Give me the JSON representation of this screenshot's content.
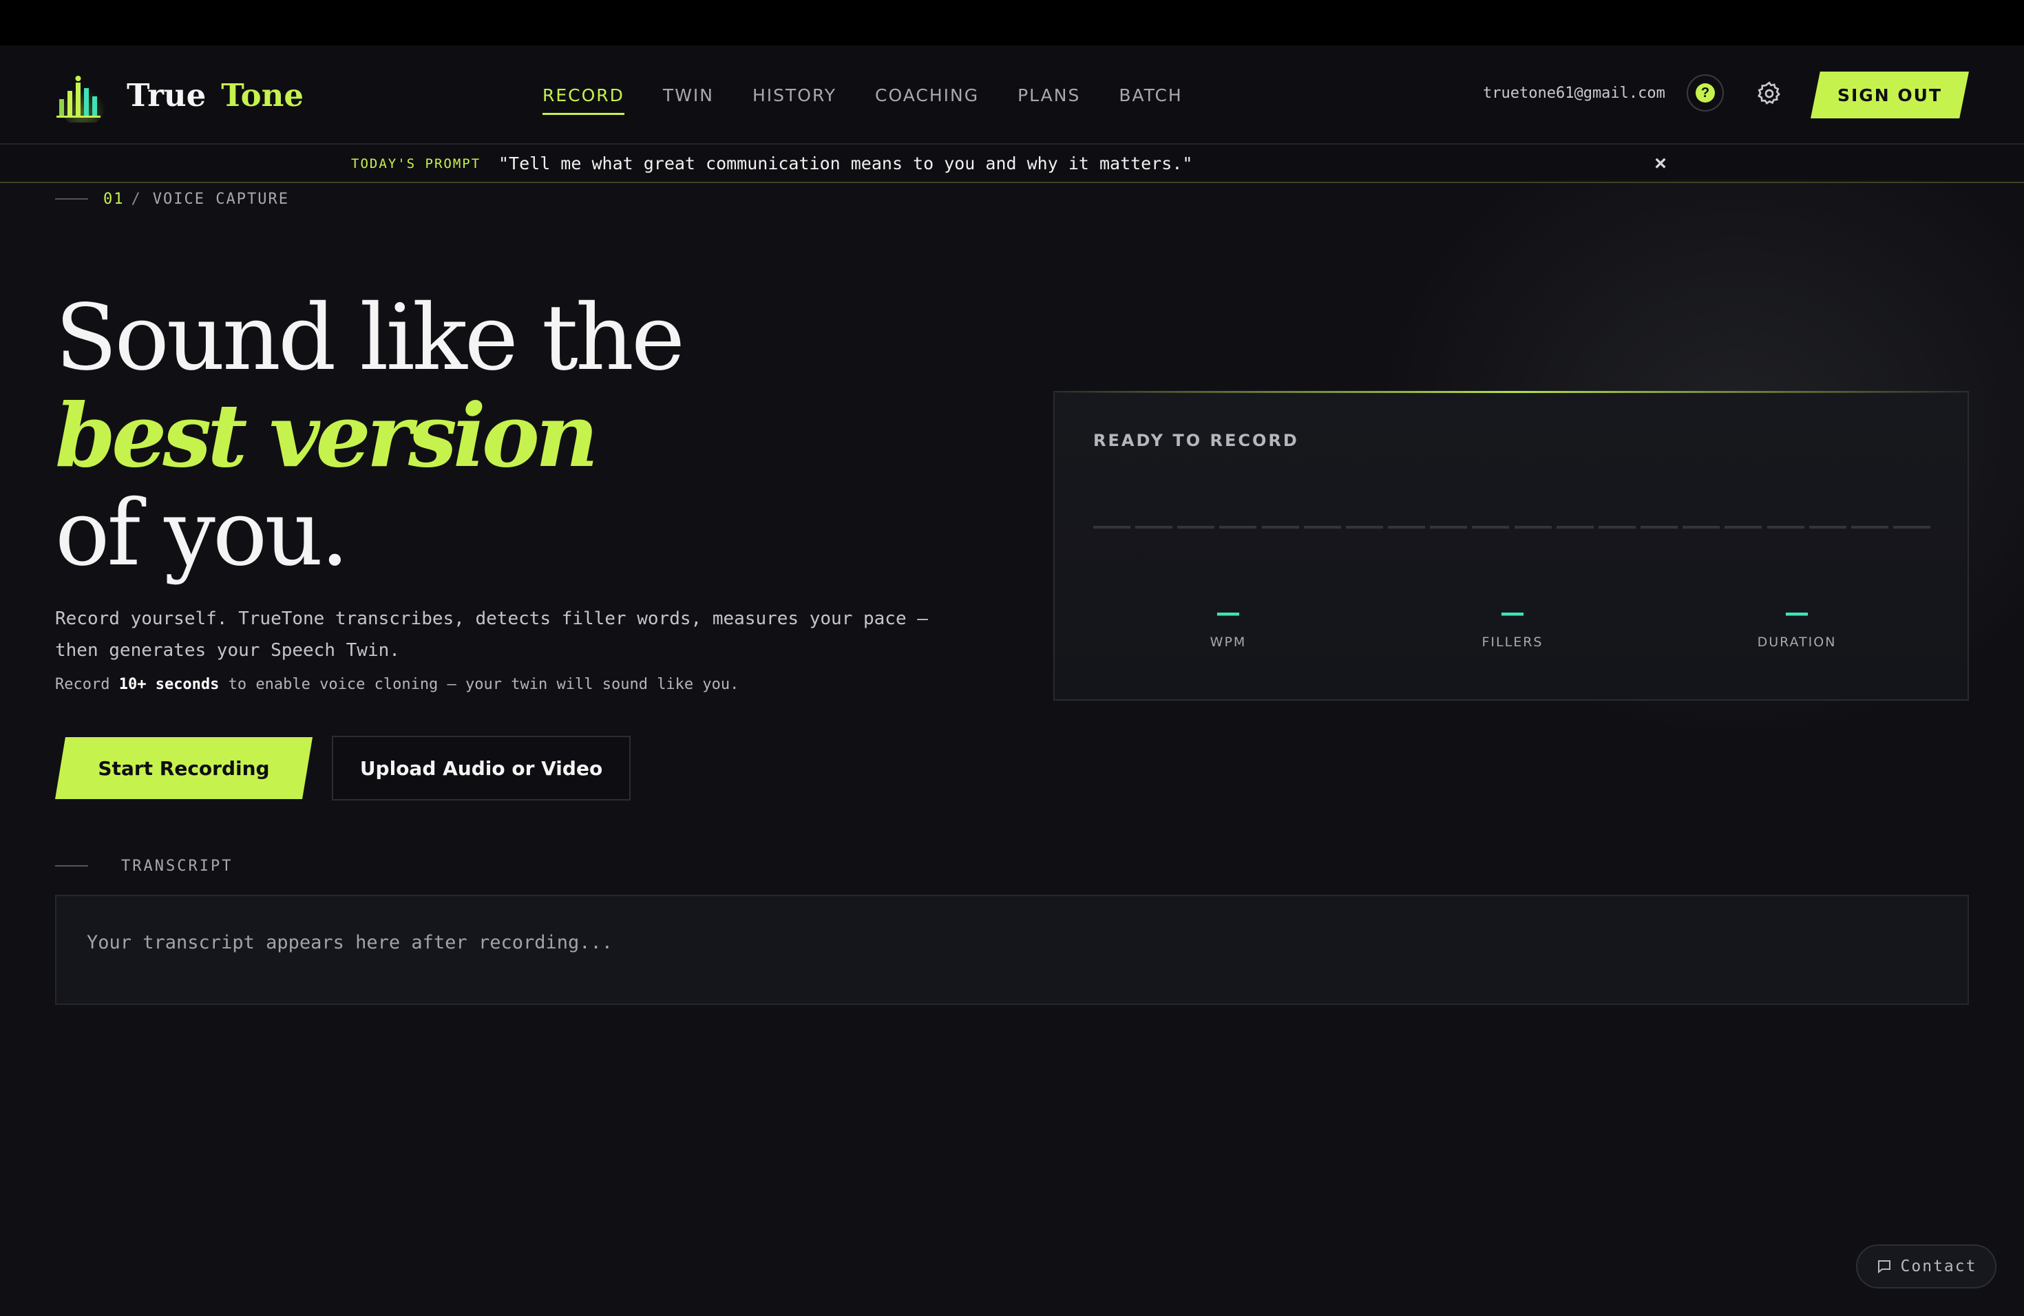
{
  "brand": {
    "name_part1": "True",
    "name_part2": "Tone"
  },
  "nav": {
    "items": [
      {
        "label": "RECORD",
        "active": true
      },
      {
        "label": "TWIN",
        "active": false
      },
      {
        "label": "HISTORY",
        "active": false
      },
      {
        "label": "COACHING",
        "active": false
      },
      {
        "label": "PLANS",
        "active": false
      },
      {
        "label": "BATCH",
        "active": false
      }
    ]
  },
  "account": {
    "email": "truetone61@gmail.com",
    "help_icon": "?",
    "signout_label": "SIGN OUT"
  },
  "prompt": {
    "label": "TODAY'S PROMPT",
    "text": "\"Tell me what great communication means to you and why it matters.\"",
    "close_glyph": "×"
  },
  "section": {
    "number": "01",
    "slash": "/",
    "name": "VOICE CAPTURE"
  },
  "hero": {
    "line1": "Sound like the",
    "line2": "best version",
    "line3": "of you."
  },
  "description": {
    "line1": "Record yourself. TrueTone transcribes, detects filler words, measures your pace —",
    "line2": "then generates your Speech Twin.",
    "note_pre": "Record ",
    "note_bold": "10+ seconds",
    "note_post": " to enable voice cloning — your twin will sound like you."
  },
  "buttons": {
    "start": "Start Recording",
    "upload": "Upload Audio or Video"
  },
  "recorder": {
    "status": "READY TO RECORD",
    "metrics": [
      {
        "value": "—",
        "label": "WPM"
      },
      {
        "value": "—",
        "label": "FILLERS"
      },
      {
        "value": "—",
        "label": "DURATION"
      }
    ]
  },
  "transcript": {
    "label": "TRANSCRIPT",
    "placeholder": "Your transcript appears here after recording..."
  },
  "contact": {
    "label": "Contact"
  },
  "colors": {
    "accent": "#c6f24e",
    "metric": "#3fe3b8",
    "background": "#101014"
  }
}
